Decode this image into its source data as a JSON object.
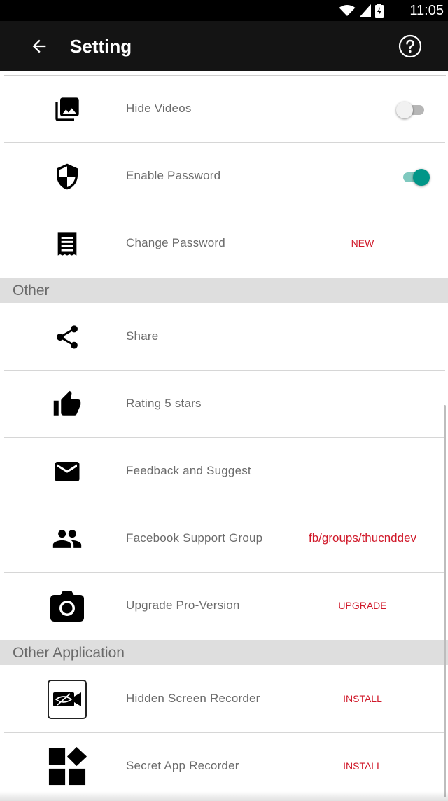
{
  "status_bar": {
    "time": "11:05",
    "icons": [
      "wifi-icon",
      "cell-signal-icon",
      "battery-icon"
    ]
  },
  "app_bar": {
    "title": "Setting",
    "back_icon": "arrow-left-icon",
    "help_icon": "help-circle-icon"
  },
  "rows_top": [
    {
      "icon": "photo-library-icon",
      "label": "Hide Videos",
      "toggle": "off"
    },
    {
      "icon": "shield-icon",
      "label": "Enable Password",
      "toggle": "on"
    },
    {
      "icon": "receipt-icon",
      "label": "Change Password",
      "tag": "NEW"
    }
  ],
  "section_other": {
    "label": "Other"
  },
  "rows_other": [
    {
      "icon": "share-icon",
      "label": "Share"
    },
    {
      "icon": "thumbs-up-icon",
      "label": "Rating 5 stars"
    },
    {
      "icon": "mail-icon",
      "label": "Feedback and Suggest"
    },
    {
      "icon": "people-icon",
      "label": "Facebook Support Group",
      "tag": "fb/groups/thucnddev"
    },
    {
      "icon": "camera-icon",
      "label": "Upgrade Pro-Version",
      "tag": "UPGRADE"
    }
  ],
  "section_apps": {
    "label": "Other Application"
  },
  "rows_apps": [
    {
      "icon": "hidden-recorder-icon",
      "label": "Hidden Screen Recorder",
      "tag": "INSTALL"
    },
    {
      "icon": "widgets-icon",
      "label": "Secret App Recorder",
      "tag": "INSTALL"
    }
  ],
  "colors": {
    "accent": "#009688",
    "tag_red": "#d0192a",
    "app_bar": "#141414",
    "section_bg": "#dedede"
  }
}
